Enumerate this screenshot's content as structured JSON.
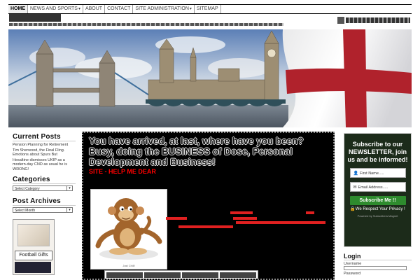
{
  "nav": {
    "items": [
      {
        "label": "HOME",
        "active": true,
        "dropdown": false
      },
      {
        "label": "NEWS AND SPORTS",
        "active": false,
        "dropdown": true
      },
      {
        "label": "ABOUT",
        "active": false,
        "dropdown": false
      },
      {
        "label": "CONTACT",
        "active": false,
        "dropdown": false
      },
      {
        "label": "SITE ADMINISTRATION",
        "active": false,
        "dropdown": true
      },
      {
        "label": "SITEMAP",
        "active": false,
        "dropdown": false
      }
    ]
  },
  "sidebar_left": {
    "current_posts_title": "Current Posts",
    "posts": [
      "Pension Planning for Retirement",
      "Tim Sherwood, the Final Fling. Emotions about Spurs But",
      "Hesaltine dismisses UKIP as a modern-day CND as usual he is WRONG!"
    ],
    "categories_title": "Categories",
    "categories_select": "Select Category",
    "archives_title": "Post Archives",
    "archives_select": "Select Month",
    "ad_label": "Football Gifts"
  },
  "main": {
    "title": "You have arrived, at last, where have you been? Busy, doing the BUSINESS of Dose, Personal Development and Business!",
    "subtitle": "SITE - HELP ME DEAR",
    "monkey_caption": "Just Chill!"
  },
  "sidebar_right": {
    "newsletter_title": "Subscribe to our NEWSLETTER, join us and be informed!",
    "name_placeholder": "First Name.....",
    "email_placeholder": "Email Address.....",
    "subscribe_button": "Subscribe Me !!",
    "privacy": "We Respect Your Privacy !",
    "powered": "Powered by Subscribers Magnet",
    "login_title": "Login",
    "username_label": "Username",
    "password_label": "Password"
  },
  "icons": {
    "user_field": "user-icon",
    "email_field": "envelope-icon",
    "lock": "lock-icon",
    "dropdown": "chevron-down-icon"
  },
  "colors": {
    "main_bg": "#000000",
    "red_text": "#ff0000",
    "newsletter_bg": "#1c2b1a",
    "subscribe_green": "#2e8b2e",
    "flag_red": "#b0222c"
  }
}
